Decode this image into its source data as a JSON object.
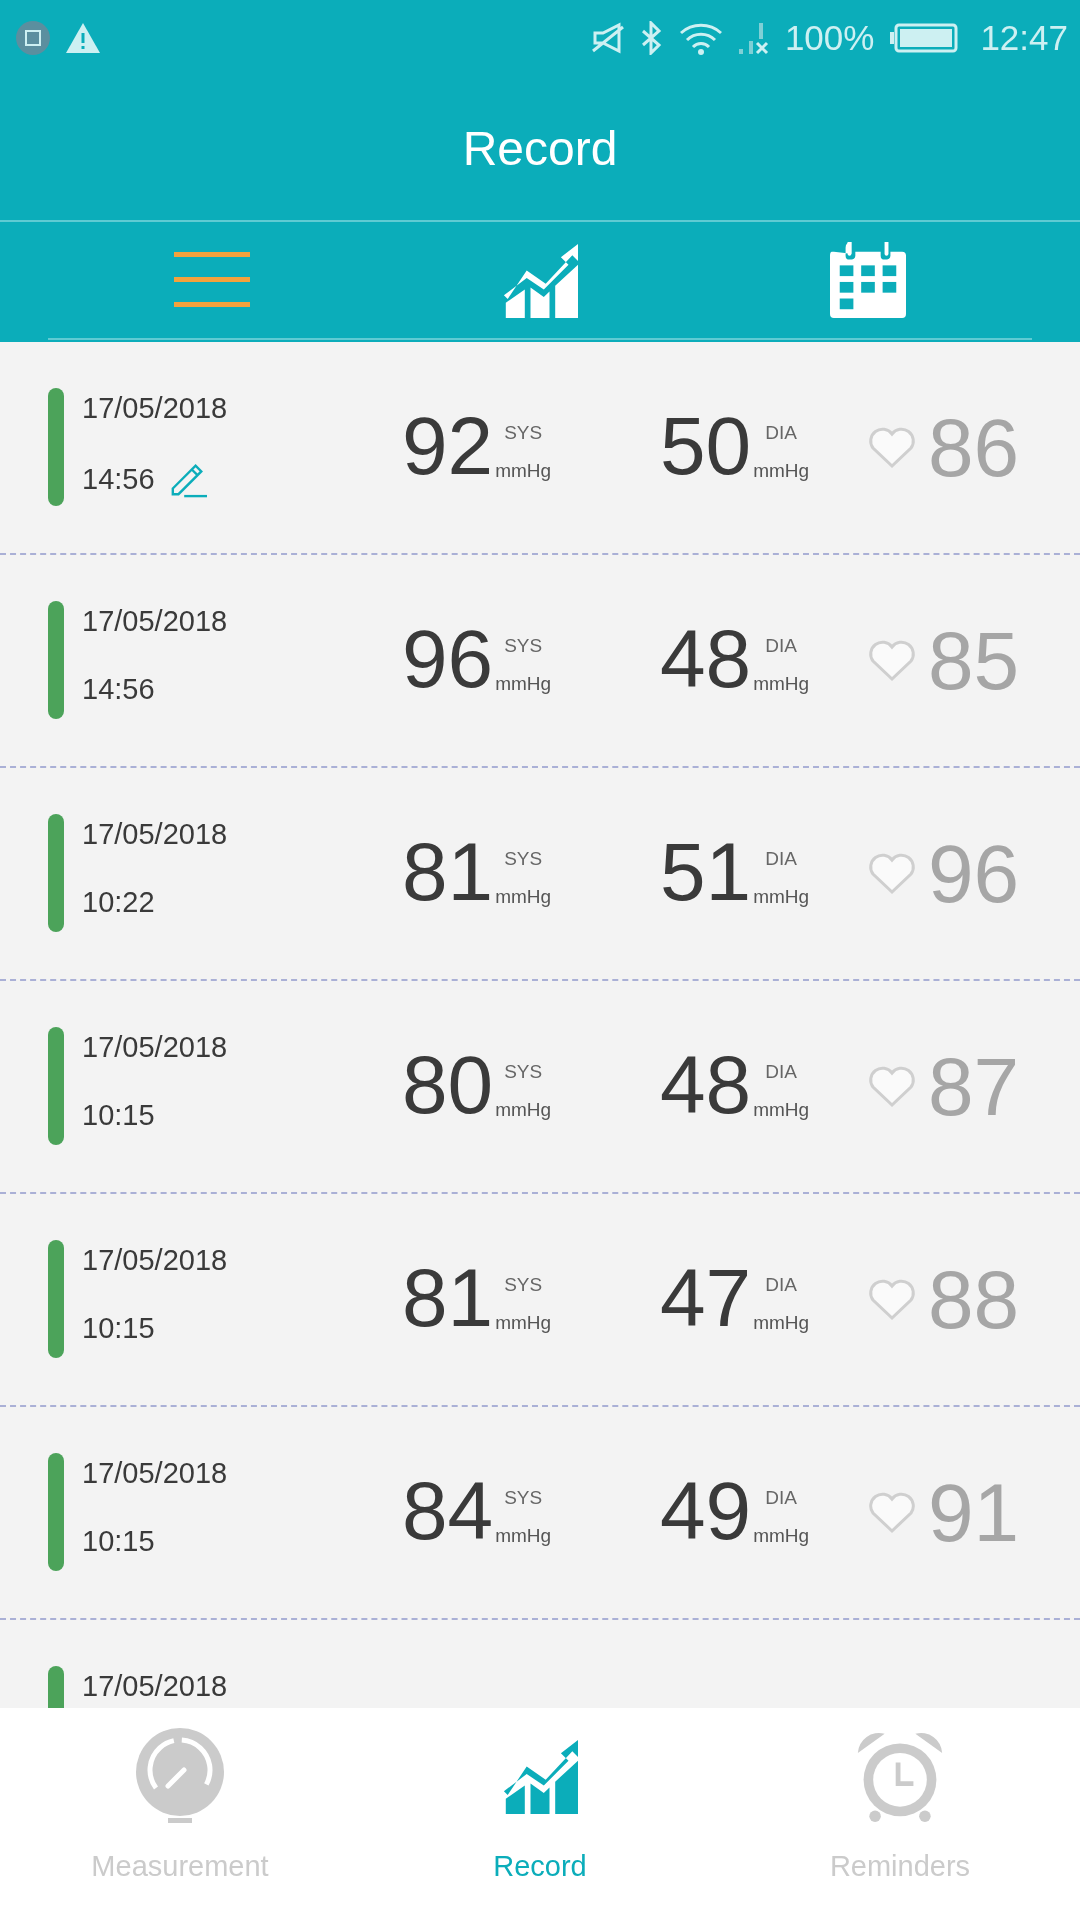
{
  "status_bar": {
    "battery": "100%",
    "time": "12:47"
  },
  "header": {
    "title": "Record"
  },
  "view_tabs": [
    {
      "kind": "list",
      "selected": true
    },
    {
      "kind": "chart",
      "selected": false
    },
    {
      "kind": "calendar",
      "selected": false
    }
  ],
  "records": [
    {
      "date": "17/05/2018",
      "time": "14:56",
      "edited": true,
      "color": "#4ca35a",
      "sys": "92",
      "sys_label": "SYS",
      "sys_unit": "mmHg",
      "dia": "50",
      "dia_label": "DIA",
      "dia_unit": "mmHg",
      "pulse": "86"
    },
    {
      "date": "17/05/2018",
      "time": "14:56",
      "edited": false,
      "color": "#4ca35a",
      "sys": "96",
      "sys_label": "SYS",
      "sys_unit": "mmHg",
      "dia": "48",
      "dia_label": "DIA",
      "dia_unit": "mmHg",
      "pulse": "85"
    },
    {
      "date": "17/05/2018",
      "time": "10:22",
      "edited": false,
      "color": "#4ca35a",
      "sys": "81",
      "sys_label": "SYS",
      "sys_unit": "mmHg",
      "dia": "51",
      "dia_label": "DIA",
      "dia_unit": "mmHg",
      "pulse": "96"
    },
    {
      "date": "17/05/2018",
      "time": "10:15",
      "edited": false,
      "color": "#4ca35a",
      "sys": "80",
      "sys_label": "SYS",
      "sys_unit": "mmHg",
      "dia": "48",
      "dia_label": "DIA",
      "dia_unit": "mmHg",
      "pulse": "87"
    },
    {
      "date": "17/05/2018",
      "time": "10:15",
      "edited": false,
      "color": "#4ca35a",
      "sys": "81",
      "sys_label": "SYS",
      "sys_unit": "mmHg",
      "dia": "47",
      "dia_label": "DIA",
      "dia_unit": "mmHg",
      "pulse": "88"
    },
    {
      "date": "17/05/2018",
      "time": "10:15",
      "edited": false,
      "color": "#4ca35a",
      "sys": "84",
      "sys_label": "SYS",
      "sys_unit": "mmHg",
      "dia": "49",
      "dia_label": "DIA",
      "dia_unit": "mmHg",
      "pulse": "91"
    },
    {
      "date": "17/05/2018",
      "color": "#4ca35a"
    }
  ],
  "bottom_nav": [
    {
      "kind": "measurement",
      "label": "Measurement",
      "selected": false
    },
    {
      "kind": "record",
      "label": "Record",
      "selected": true
    },
    {
      "kind": "reminders",
      "label": "Reminders",
      "selected": false
    }
  ]
}
